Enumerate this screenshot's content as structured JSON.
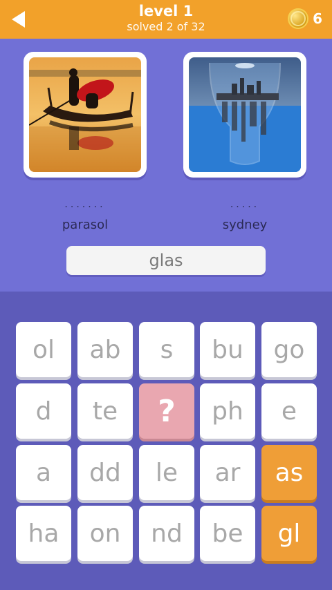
{
  "header": {
    "title": "level 1",
    "subtitle": "solved 2 of 32",
    "coins": "6"
  },
  "puzzle": {
    "left": {
      "dots": ".......",
      "word": "parasol",
      "image": "person with red parasol in a gondola at sunset"
    },
    "right": {
      "dots": ".....",
      "word": "sydney",
      "image": "Sydney skyline reflected in a wine glass"
    },
    "answer": "glas"
  },
  "tiles": [
    [
      "ol",
      "ab",
      "s",
      "bu",
      "go"
    ],
    [
      "d",
      "te",
      "?",
      "ph",
      "e"
    ],
    [
      "a",
      "dd",
      "le",
      "ar",
      "as"
    ],
    [
      "ha",
      "on",
      "nd",
      "be",
      "gl"
    ]
  ],
  "colors": {
    "header": "#f2a12a",
    "background": "#7170d6",
    "board": "#5d5bb9",
    "hint_tile": "#e9a7b0",
    "used_tile": "#ef9e37"
  }
}
